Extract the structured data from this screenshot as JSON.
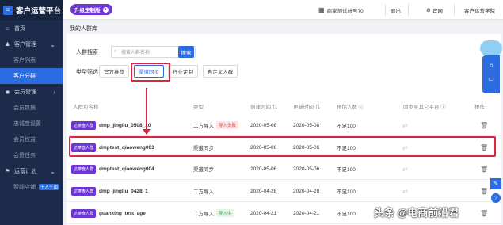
{
  "app": {
    "logo_icon": "≡",
    "title": "客户运营平台"
  },
  "upgrade": {
    "label": "升级定制版",
    "close": "×"
  },
  "topbar": {
    "shop_icon": "▦",
    "account": "商家测试帐号70",
    "logout": "退出",
    "official_icon": "⚙",
    "official": "官网",
    "academy": "客户运营学院"
  },
  "sidebar": {
    "items": [
      {
        "icon": "⌂",
        "label": "首页"
      },
      {
        "icon": "♟",
        "label": "客户管理",
        "arrow": "⌄"
      },
      {
        "label": "客户列表"
      },
      {
        "label": "客户分群"
      },
      {
        "icon": "◉",
        "label": "会员管理",
        "arrow": "›"
      },
      {
        "label": "会员数据"
      },
      {
        "label": "忠诚度设置"
      },
      {
        "label": "会员权益"
      },
      {
        "label": "会员任务"
      },
      {
        "icon": "⚑",
        "label": "运营计划",
        "arrow": "⌄"
      },
      {
        "label": "智能店铺",
        "tag": "千人千面"
      }
    ]
  },
  "breadcrumb": "我的人群库",
  "filters": {
    "search_label": "人群搜索",
    "search_placeholder": "搜索人群名称",
    "search_button": "搜索",
    "type_label": "类型筛选",
    "types": [
      "官方推荐",
      "渠道同步",
      "行业定制",
      "自定义人群"
    ]
  },
  "table": {
    "headers": [
      "人群包名称",
      "类型",
      "创建时间 ⇅",
      "更新时间 ⇅",
      "预估人数 ⓘ",
      "同步至其它平台 ⓘ",
      "操作"
    ],
    "rows": [
      {
        "badge": "达摩盘人群",
        "name": "dmp_jingliu_0508_10",
        "type": "二方导入",
        "status": "导入失败",
        "status_kind": "fail",
        "created": "2020-05-08",
        "updated": "2020-05-08",
        "estimate": "不足100"
      },
      {
        "badge": "达摩盘人群",
        "name": "dmptest_qiaoweng003",
        "type": "渠道同步",
        "status": "",
        "status_kind": "",
        "created": "2020-05-06",
        "updated": "2020-05-06",
        "estimate": "不足100"
      },
      {
        "badge": "达摩盘人群",
        "name": "dmptest_qiaoweng004",
        "type": "渠道同步",
        "status": "",
        "status_kind": "",
        "created": "2020-05-06",
        "updated": "2020-05-06",
        "estimate": "不足100"
      },
      {
        "badge": "达摩盘人群",
        "name": "dmp_jingliu_0428_1",
        "type": "二方导入",
        "status": "",
        "status_kind": "",
        "created": "2020-04-28",
        "updated": "2020-04-28",
        "estimate": "不足100"
      },
      {
        "badge": "达摩盘人群",
        "name": "guanxing_test_age",
        "type": "二方导入",
        "status": "导入中",
        "status_kind": "ing",
        "created": "2020-04-21",
        "updated": "2020-04-21",
        "estimate": "不足100"
      }
    ],
    "sync_icon": "⇄",
    "trash_icon": "🗑"
  },
  "float": {
    "bell_icon": "♫",
    "chat_icon": "▭",
    "edit_icon": "✎",
    "help_icon": "?"
  },
  "watermark": "头条 @电商前沿君"
}
